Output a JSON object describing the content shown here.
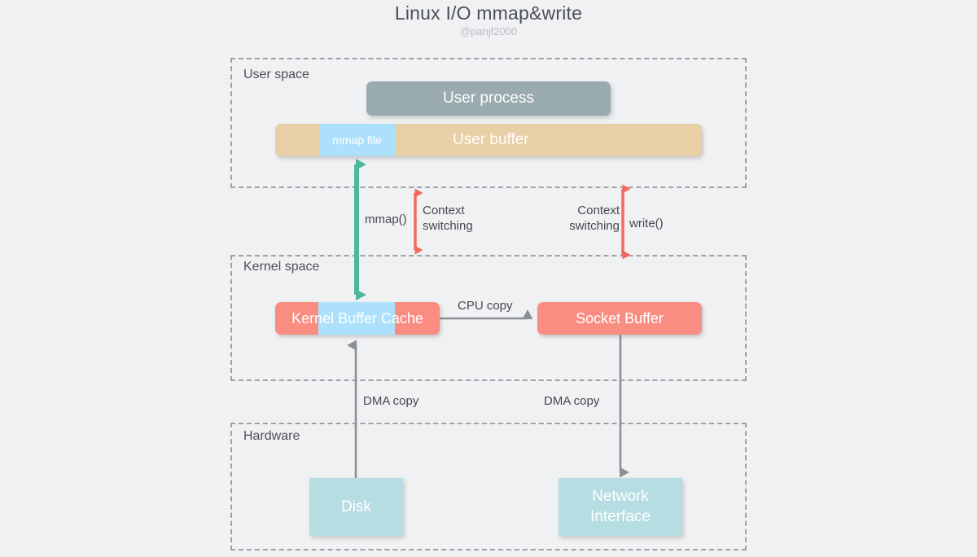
{
  "header": {
    "title": "Linux I/O mmap&write",
    "subtitle": "@panjf2000"
  },
  "regions": [
    {
      "id": "user-space",
      "label": "User space"
    },
    {
      "id": "kernel-space",
      "label": "Kernel space"
    },
    {
      "id": "hardware",
      "label": "Hardware"
    }
  ],
  "blocks": {
    "user_process": "User process",
    "user_buffer": "User buffer",
    "mmap_file": "mmap file",
    "kernel_buffer_cache": "Kernel Buffer Cache",
    "socket_buffer": "Socket Buffer",
    "disk": "Disk",
    "network_interface_line1": "Network",
    "network_interface_line2": "Interface"
  },
  "arrow_labels": {
    "mmap_call": "mmap()",
    "context_switching_left": "Context\nswitching",
    "context_switching_right": "Context\nswitching",
    "write_call": "write()",
    "cpu_copy": "CPU copy",
    "dma_copy_left": "DMA copy",
    "dma_copy_right": "DMA copy"
  },
  "colors": {
    "background": "#f0f1f3",
    "region_border": "#9ea2a6",
    "user_process": "#9aabb0",
    "user_buffer": "#e9cfa6",
    "mmap_file": "#ade1fb",
    "kernel_buffer": "#f98d81",
    "kernel_buffer_mid": "#ade1fb",
    "socket_buffer": "#f98d81",
    "hardware_block": "#b5dde2",
    "mmap_arrow": "#4db89f",
    "context_arrow": "#f4695e",
    "copy_arrow": "#8c9094",
    "title_text": "#4c4f54",
    "subtitle_text": "#b9bdc2"
  }
}
